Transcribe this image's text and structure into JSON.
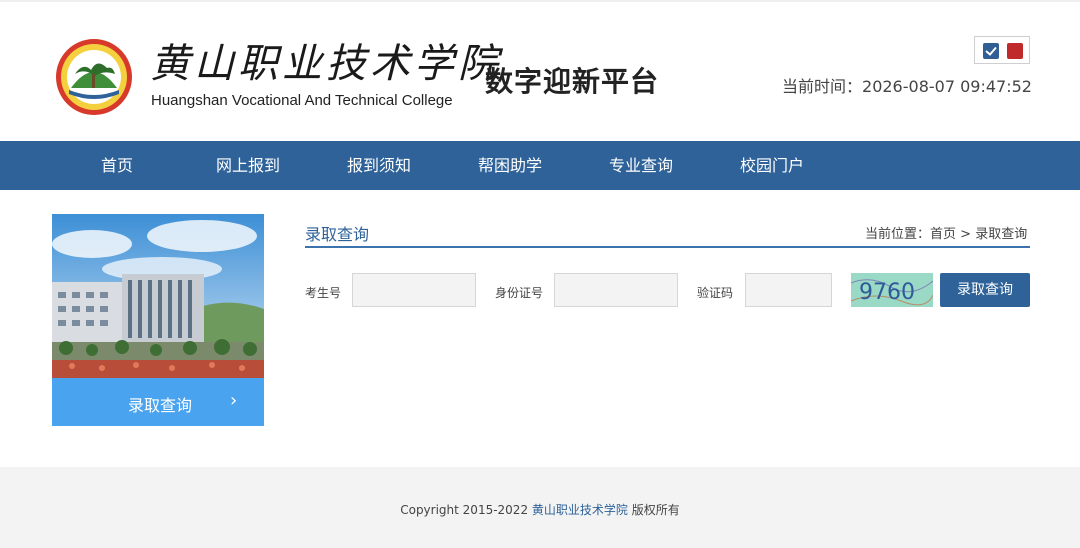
{
  "header": {
    "college_name_cn": "黄山职业技术学院",
    "college_name_en": "Huangshan Vocational And Technical College",
    "platform_title": "数字迎新平台",
    "time_label": "当前时间：",
    "time_value": "2026-08-07 09:47:52",
    "toggle_colors": {
      "blue": "#2f5f94",
      "red": "#c12a2a"
    }
  },
  "nav": {
    "items": [
      {
        "label": "首页"
      },
      {
        "label": "网上报到"
      },
      {
        "label": "报到须知"
      },
      {
        "label": "帮困助学"
      },
      {
        "label": "专业查询"
      },
      {
        "label": "校园门户"
      }
    ],
    "background": "#2e6299"
  },
  "sidebar": {
    "button_label": "录取查询",
    "button_icon": "chevron-right-icon"
  },
  "main": {
    "section_title": "录取查询",
    "breadcrumb": {
      "prefix": "当前位置：",
      "home": "首页",
      "separator": ">",
      "current": "录取查询"
    },
    "form": {
      "exam_label": "考生号",
      "exam_value": "",
      "id_label": "身份证号",
      "id_value": "",
      "captcha_label": "验证码",
      "captcha_value": "",
      "captcha_image_text": "9760",
      "submit_label": "录取查询"
    }
  },
  "footer": {
    "copyright_prefix": "Copyright 2015-2022",
    "college_link": "黄山职业技术学院",
    "rights": "版权所有"
  }
}
